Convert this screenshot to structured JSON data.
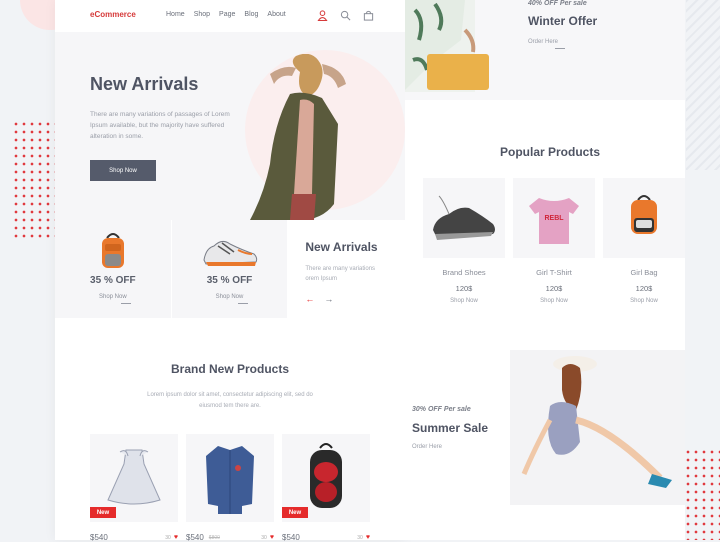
{
  "left_page": {
    "nav": {
      "logo": "eCommerce",
      "links": [
        "Home",
        "Shop",
        "Page",
        "Blog",
        "About"
      ],
      "icons": [
        "user-icon",
        "search-icon",
        "cart-icon"
      ]
    },
    "hero": {
      "title": "New Arrivals",
      "text": "There are many variations of passages of Lorem Ipsum available, but the majority have suffered alteration in some.",
      "button": "Shop Now"
    },
    "offers": [
      {
        "label": "35 % OFF",
        "link": "Shop Now",
        "image": "orange-backpack"
      },
      {
        "label": "35 % OFF",
        "link": "Shop Now",
        "image": "running-shoe"
      }
    ],
    "offer_info": {
      "title": "New Arrivals",
      "text": "There are many variations orem Ipsum",
      "prev": "←",
      "next": "→"
    },
    "brand": {
      "title": "Brand New Products",
      "subtitle": "Lorem ipsum dolor sit amet, consectetur adipiscing elit, sed do eiusmod tem there are.",
      "products": [
        {
          "image": "white-dress",
          "badge": "New",
          "price": "$540",
          "old_price": "",
          "likes": "30"
        },
        {
          "image": "blue-shirt",
          "badge": "",
          "price": "$540",
          "old_price": "$800",
          "likes": "30"
        },
        {
          "image": "red-backpack",
          "badge": "New",
          "price": "$540",
          "old_price": "",
          "likes": "30"
        }
      ]
    }
  },
  "right_page": {
    "winter": {
      "discount": "40% OFF Per sale",
      "title": "Winter Offer",
      "link": "Order Here"
    },
    "popular": {
      "title": "Popular Products",
      "products": [
        {
          "name": "Brand Shoes",
          "price": "120$",
          "link": "Shop Now",
          "image": "black-sneaker"
        },
        {
          "name": "Girl T-Shirt",
          "price": "120$",
          "link": "Shop Now",
          "image": "pink-tshirt"
        },
        {
          "name": "Girl Bag",
          "price": "120$",
          "link": "Shop Now",
          "image": "orange-backpack"
        }
      ]
    },
    "summer": {
      "discount": "30% OFF Per sale",
      "title": "Summer Sale",
      "link": "Order Here"
    }
  },
  "colors": {
    "accent": "#e52b2b",
    "button": "#555b6b",
    "heading": "#4f5463"
  }
}
